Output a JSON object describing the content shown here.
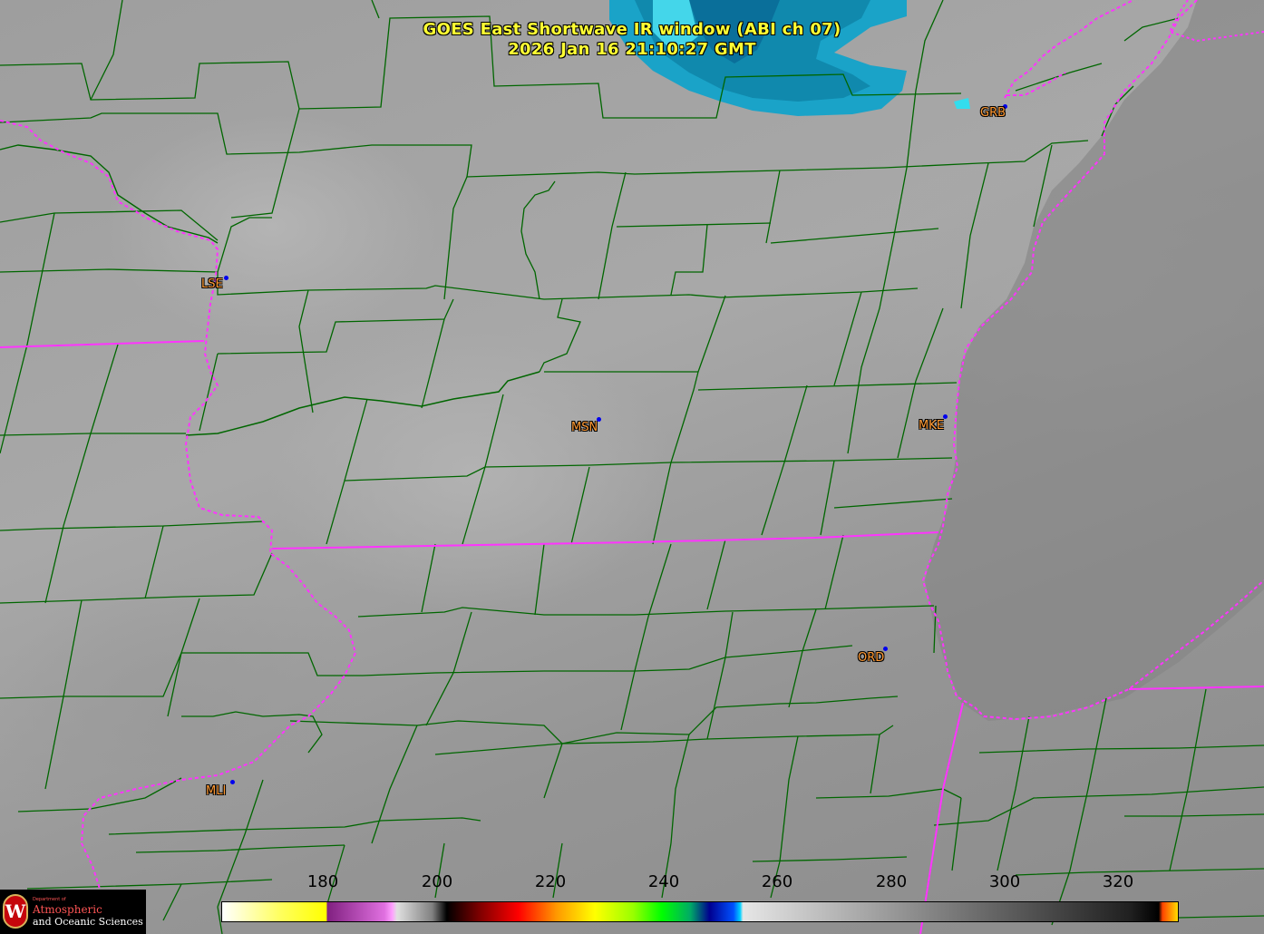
{
  "title": {
    "line1": "GOES East Shortwave IR window (ABI ch 07)",
    "line2": "2026 Jan 16  21:10:27 GMT"
  },
  "stations": [
    {
      "code": "GRB"
    },
    {
      "code": "LSE"
    },
    {
      "code": "MSN"
    },
    {
      "code": "MKE"
    },
    {
      "code": "ORD"
    },
    {
      "code": "MLI"
    }
  ],
  "colorbar": {
    "ticks": [
      "180",
      "200",
      "220",
      "240",
      "260",
      "280",
      "300",
      "320"
    ]
  },
  "logo": {
    "seal": "W",
    "dept": "Department of",
    "line1": "Atmospheric",
    "line2": "and Oceanic Sciences"
  },
  "colors": {
    "county_lines": "#006600",
    "state_lines": "#ff33ff",
    "title_text": "#ffff33",
    "station_label": "#ff9933",
    "station_dot": "#0000ee",
    "cold_cloud": "#00c8e6"
  },
  "icons": [
    "uw-seal-icon"
  ]
}
